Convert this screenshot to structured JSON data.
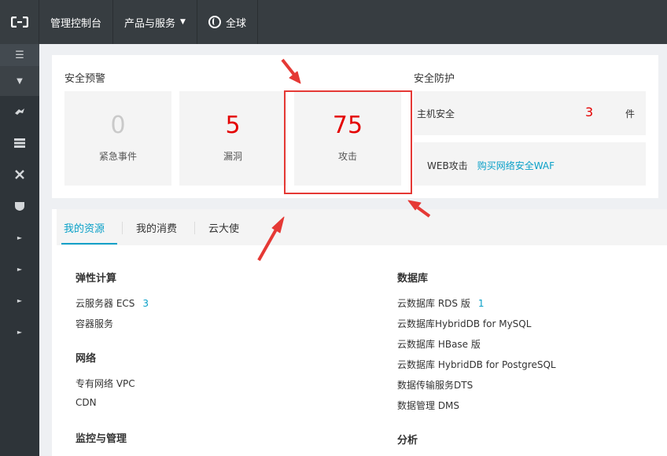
{
  "topbar": {
    "console_label": "管理控制台",
    "products_label": "产品与服务",
    "region_label": "全球"
  },
  "sidebar": {
    "menu_glyph": "☰",
    "collapse_glyph": "▼",
    "expand_glyph": "►"
  },
  "security_alerts": {
    "title": "安全预警",
    "tiles": [
      {
        "value": "0",
        "label": "紧急事件"
      },
      {
        "value": "5",
        "label": "漏洞"
      },
      {
        "value": "75",
        "label": "攻击"
      }
    ]
  },
  "security_protection": {
    "title": "安全防护",
    "host_label": "主机安全",
    "host_count": "3",
    "host_unit": "件",
    "web_label": "WEB攻击",
    "waf_link": "购买网络安全WAF"
  },
  "tabs": [
    "我的资源",
    "我的消费",
    "云大使"
  ],
  "resources": {
    "compute": {
      "title": "弹性计算",
      "items": [
        {
          "label": "云服务器 ECS",
          "count": "3"
        },
        {
          "label": "容器服务",
          "count": ""
        }
      ]
    },
    "network": {
      "title": "网络",
      "items": [
        {
          "label": "专有网络 VPC"
        },
        {
          "label": "CDN"
        }
      ]
    },
    "monitor": {
      "title": "监控与管理"
    },
    "database": {
      "title": "数据库",
      "items": [
        {
          "label": "云数据库 RDS 版",
          "count": "1"
        },
        {
          "label": "云数据库HybridDB for MySQL"
        },
        {
          "label": "云数据库 HBase 版"
        },
        {
          "label": "云数据库 HybridDB for PostgreSQL"
        },
        {
          "label": "数据传输服务DTS"
        },
        {
          "label": "数据管理 DMS"
        }
      ]
    },
    "analytics": {
      "title": "分析"
    }
  },
  "colors": {
    "topbar": "#373d41",
    "sidebar": "#2e3439",
    "accent": "#0aa0c8",
    "alert_red": "#e40000",
    "annotation_red": "#e53935"
  }
}
